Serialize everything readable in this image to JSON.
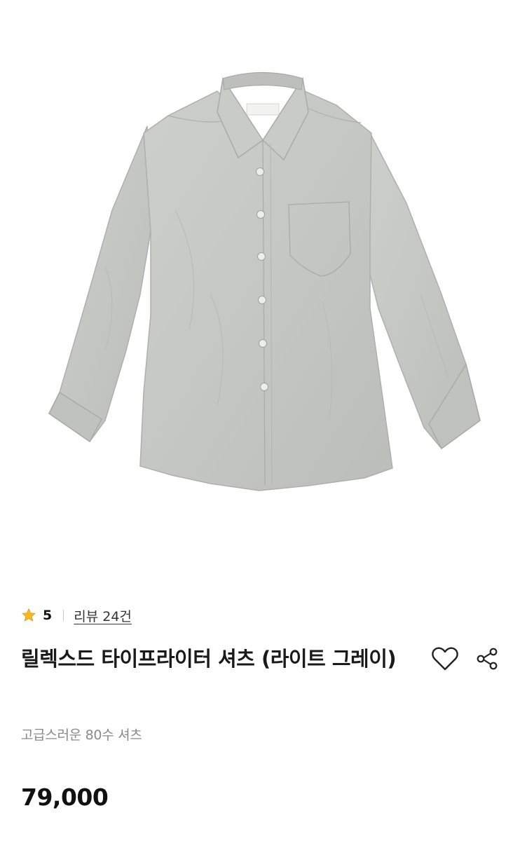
{
  "product": {
    "image_alt": "light grey long sleeve button-up shirt",
    "rating": "5",
    "review_link": "리뷰 24건",
    "title": "릴렉스드 타이프라이터 셔츠 (라이트 그레이)",
    "subtitle": "고급스러운 80수 셔츠",
    "price": "79,000"
  },
  "colors": {
    "star": "#F5B820",
    "shirt": "#C7C9C5",
    "text_primary": "#1a1a1a",
    "text_secondary": "#8a8a8a"
  },
  "icons": {
    "rating": "star-icon",
    "wishlist": "heart-outline-icon",
    "share": "share-icon"
  }
}
